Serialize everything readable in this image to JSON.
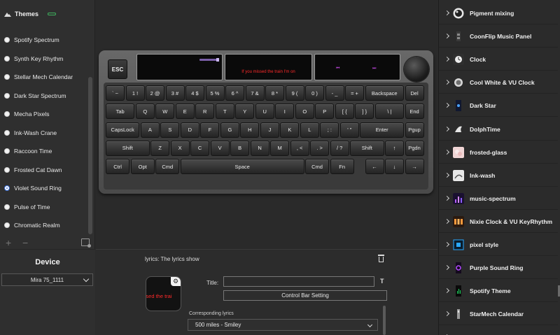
{
  "themes": {
    "title": "Themes",
    "items": [
      {
        "label": "Spotify Spectrum",
        "selected": false
      },
      {
        "label": "Synth Key Rhythm",
        "selected": false
      },
      {
        "label": "Stellar Mech Calendar",
        "selected": false
      },
      {
        "label": "Dark Star Spectrum",
        "selected": false
      },
      {
        "label": "Mecha Pixels",
        "selected": false
      },
      {
        "label": "Ink-Wash Crane",
        "selected": false
      },
      {
        "label": "Raccoon Time",
        "selected": false
      },
      {
        "label": "Frosted Cat Dawn",
        "selected": false
      },
      {
        "label": "Violet Sound Ring",
        "selected": true
      },
      {
        "label": "Pulse of Time",
        "selected": false
      },
      {
        "label": "Chromatic Realm",
        "selected": false
      }
    ],
    "add_label": "+",
    "remove_label": "−"
  },
  "device": {
    "title": "Device",
    "selected": "Mira 75_1111"
  },
  "keyboard": {
    "esc_label": "ESC",
    "screen_lyric": "If you missed the train I'm on",
    "prev_glyph": "⏮",
    "next_glyph": "⏭",
    "rows": [
      [
        {
          "l": "` ~",
          "w": 1
        },
        {
          "l": "1 !",
          "w": 1
        },
        {
          "l": "2 @",
          "w": 1
        },
        {
          "l": "3 #",
          "w": 1
        },
        {
          "l": "4 $",
          "w": 1
        },
        {
          "l": "5 %",
          "w": 1
        },
        {
          "l": "6 ^",
          "w": 1
        },
        {
          "l": "7 &",
          "w": 1
        },
        {
          "l": "8 *",
          "w": 1
        },
        {
          "l": "9 (",
          "w": 1
        },
        {
          "l": "0 )",
          "w": 1
        },
        {
          "l": "- _",
          "w": 1
        },
        {
          "l": "= +",
          "w": 1
        },
        {
          "l": "Backspace",
          "w": 2
        },
        {
          "l": "Del",
          "w": 1
        }
      ],
      [
        {
          "l": "Tab",
          "w": 1.5
        },
        {
          "l": "Q",
          "w": 1
        },
        {
          "l": "W",
          "w": 1
        },
        {
          "l": "E",
          "w": 1
        },
        {
          "l": "R",
          "w": 1
        },
        {
          "l": "T",
          "w": 1
        },
        {
          "l": "Y",
          "w": 1
        },
        {
          "l": "U",
          "w": 1
        },
        {
          "l": "I",
          "w": 1
        },
        {
          "l": "O",
          "w": 1
        },
        {
          "l": "P",
          "w": 1
        },
        {
          "l": "[ {",
          "w": 1
        },
        {
          "l": "] }",
          "w": 1
        },
        {
          "l": "\\ |",
          "w": 1.5
        },
        {
          "l": "End",
          "w": 1
        }
      ],
      [
        {
          "l": "CapsLock",
          "w": 1.75
        },
        {
          "l": "A",
          "w": 1
        },
        {
          "l": "S",
          "w": 1
        },
        {
          "l": "D",
          "w": 1
        },
        {
          "l": "F",
          "w": 1
        },
        {
          "l": "G",
          "w": 1
        },
        {
          "l": "H",
          "w": 1
        },
        {
          "l": "J",
          "w": 1
        },
        {
          "l": "K",
          "w": 1
        },
        {
          "l": "L",
          "w": 1
        },
        {
          "l": "; :",
          "w": 1
        },
        {
          "l": "' \"",
          "w": 1
        },
        {
          "l": "Enter",
          "w": 2.25
        },
        {
          "l": "Pgup",
          "w": 1
        }
      ],
      [
        {
          "l": "Shift",
          "w": 2.25
        },
        {
          "l": "Z",
          "w": 1
        },
        {
          "l": "X",
          "w": 1
        },
        {
          "l": "C",
          "w": 1
        },
        {
          "l": "V",
          "w": 1
        },
        {
          "l": "B",
          "w": 1
        },
        {
          "l": "N",
          "w": 1
        },
        {
          "l": "M",
          "w": 1
        },
        {
          "l": ", <",
          "w": 1
        },
        {
          "l": ". >",
          "w": 1
        },
        {
          "l": "/ ?",
          "w": 1
        },
        {
          "l": "Shift",
          "w": 1.75
        },
        {
          "l": "↑",
          "w": 1
        },
        {
          "l": "Pgdn",
          "w": 1
        }
      ],
      [
        {
          "l": "Ctrl",
          "w": 1.25
        },
        {
          "l": "Opt",
          "w": 1.25
        },
        {
          "l": "Cmd",
          "w": 1.25
        },
        {
          "l": "Space",
          "w": 6.25
        },
        {
          "l": "Cmd",
          "w": 1.25
        },
        {
          "l": "Fn",
          "w": 1.25
        },
        {
          "l": "",
          "w": 0.5,
          "gap": true
        },
        {
          "l": "←",
          "w": 1
        },
        {
          "l": "↓",
          "w": 1
        },
        {
          "l": "→",
          "w": 1
        }
      ]
    ]
  },
  "lyrics": {
    "header": "lyrics: The lyrics show",
    "preview_text": "issed the trai",
    "title_label": "Title:",
    "title_value": "",
    "control_button": "Control Bar Setting",
    "corr_label": "Corresponding lyrics",
    "corr_value": "500 miles - Smiley"
  },
  "right_panel": {
    "items": [
      {
        "label": "Pigment mixing",
        "thumb": "pigment"
      },
      {
        "label": "CoonFlip Music Panel",
        "thumb": "coonflip"
      },
      {
        "label": "Clock",
        "thumb": "clock"
      },
      {
        "label": "Cool White & VU Clock",
        "thumb": "coolwhite"
      },
      {
        "label": "Dark Star",
        "thumb": "darkstar"
      },
      {
        "label": "DolphTime",
        "thumb": "dolph"
      },
      {
        "label": "frosted-glass",
        "thumb": "frosted"
      },
      {
        "label": "Ink-wash",
        "thumb": "inkwash"
      },
      {
        "label": "music-spectrum",
        "thumb": "spectrum"
      },
      {
        "label": "Nixie Clock & VU KeyRhythm",
        "thumb": "nixie"
      },
      {
        "label": "pixel style",
        "thumb": "pixel"
      },
      {
        "label": "Purple Sound Ring",
        "thumb": "purple"
      },
      {
        "label": "Spotify Theme",
        "thumb": "spotify"
      },
      {
        "label": "StarMech Calendar",
        "thumb": "starmech"
      },
      {
        "label": "",
        "thumb": "none"
      }
    ]
  }
}
